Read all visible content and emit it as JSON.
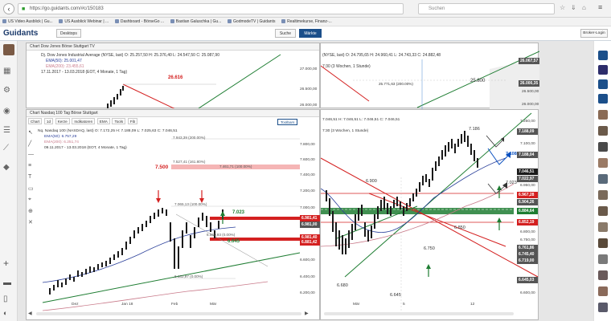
{
  "browser": {
    "url": "https://go.guidants.com/#c/150183",
    "search_placeholder": "Suchen",
    "bookmarks": [
      "US Video Ausblick | Gu...",
      "US Ausblick Webinar | ...",
      "Dashboard - BörseGo ...",
      "Bastian Galuschka | Gu...",
      "GodmodeTV | Guidants",
      "Realtimekurse, Finanz-..."
    ]
  },
  "app": {
    "logo": "Guidants",
    "desktop_button": "Desktops",
    "search_button": "Suche",
    "market_button": "Märkte",
    "broker_button": "Broker-Login"
  },
  "colors": {
    "red": "#d42020",
    "green": "#1e7d32",
    "candle_up": "#1a1a1a",
    "ema_blue": "#2a3f9a",
    "ema_pink": "#c97a8a",
    "accent_blue": "#0a50c0",
    "grey_tag": "#555555"
  },
  "dow_chart": {
    "title": "Chart Dow Jones Börse Stuttgart TV",
    "header_line": "Dj. Dow Jones Industrial Average (NYSE, last)  O: 25.257,50  H: 25.376,40  L: 24.547,50  C: 25.087,90",
    "ema50": "EMA(50): 25.001,47",
    "ema200": "EMA(200): 23.455,61",
    "range": "17.11.2017 - 13.03.2018  (EOT, 4 Monate, 1 Tag)",
    "level_label": "26.616",
    "y_ticks": [
      "27.000,00",
      "26.500,00",
      "26.000,00"
    ]
  },
  "dow_right": {
    "header_line": "(NYSE, last)  O: 24.795,65  H: 24.960,41  L: 24.743,33  C: 24.882,48",
    "range": "7:30  (3 Wochen, 1 Stunde)",
    "level_label": "25.800",
    "level_small": "25.771,63 (200.00%)",
    "y_ticks": [
      "26.500,00",
      "26.000,00"
    ],
    "tags": [
      {
        "value": "26.067,57",
        "color": "#555555"
      },
      {
        "value": "26.000,35",
        "color": "#555555"
      }
    ]
  },
  "nasdaq_chart": {
    "title": "Chart Nasdaq 100 Tag Börse Stuttgart",
    "header_line": "Nq. Nasdaq 100 (NASDAQ, last)  O: 7.172,25  H: 7.188,09  L: 7.025,63  C: 7.046,51",
    "ema50": "EMA(50): 6.757,29",
    "ema200": "EMA(200): 6.251,74",
    "range": "09.11.2017 - 13.03.2018  (EOT, 4 Monate, 1 Tag)",
    "toolbar": [
      "Chart",
      "1d",
      "Kerze",
      "Indikatoren",
      "EMA",
      "Tools",
      "Fib",
      "Toolbars"
    ],
    "fib_labels": [
      "7.943,39 (200.00%)",
      "7.527,41 (161.80%)",
      "7.461,71 (100.00%)",
      "7.065,13 (100.00%)",
      "6.560,93 (0.00%)",
      "6.162,97 (0.00%)"
    ],
    "level_7500": "7.500",
    "level_7023": "7.023",
    "level_6645": "6.645",
    "y_ticks": [
      "7.800,00",
      "7.600,00",
      "7.400,00",
      "7.200,00",
      "7.000,00",
      "6.800,00",
      "6.600,00",
      "6.400,00",
      "6.200,00"
    ],
    "x_ticks": [
      "Dez",
      "Jan 18",
      "Feb",
      "Mär"
    ]
  },
  "nasdaq_right": {
    "header_line": "7.046,51  H: 7.046,51  L: 7.046,51  C: 7.046,51",
    "range": "7:30  (3 Wochen, 1 Stunde)",
    "labels": {
      "l7186": "7.186",
      "l7108": "7.108",
      "l7023": "7.023",
      "l6900": "6.900",
      "l6850": "6.850",
      "l6750": "6.750",
      "l6680": "6.680",
      "l6645": "6.645"
    },
    "y_ticks": [
      "7.250,00",
      "7.100,00",
      "6.950,00",
      "6.800,00",
      "6.750,00",
      "6.600,00"
    ],
    "x_ticks": [
      "Mär",
      "5",
      "12"
    ],
    "tags": [
      {
        "value": "7.188,09",
        "color": "#555555"
      },
      {
        "value": "7.188,04",
        "color": "#555555"
      },
      {
        "value": "7.046,51",
        "color": "#1a1a1a"
      },
      {
        "value": "7.022,97",
        "color": "#555555"
      },
      {
        "value": "6.967,28",
        "color": "#d42020"
      },
      {
        "value": "6.904,26",
        "color": "#555555"
      },
      {
        "value": "6.884,64",
        "color": "#1e7d32"
      },
      {
        "value": "6.852,19",
        "color": "#d42020"
      },
      {
        "value": "6.761,86",
        "color": "#555555"
      },
      {
        "value": "6.745,40",
        "color": "#555555"
      },
      {
        "value": "6.719,00",
        "color": "#555555"
      },
      {
        "value": "6.645,03",
        "color": "#555555"
      }
    ],
    "tags_left": [
      {
        "value": "6.981,41",
        "color": "#d42020"
      },
      {
        "value": "6.981,00",
        "color": "#555555"
      },
      {
        "value": "6.981,40",
        "color": "#d42020"
      },
      {
        "value": "6.881,42",
        "color": "#d42020"
      }
    ]
  }
}
